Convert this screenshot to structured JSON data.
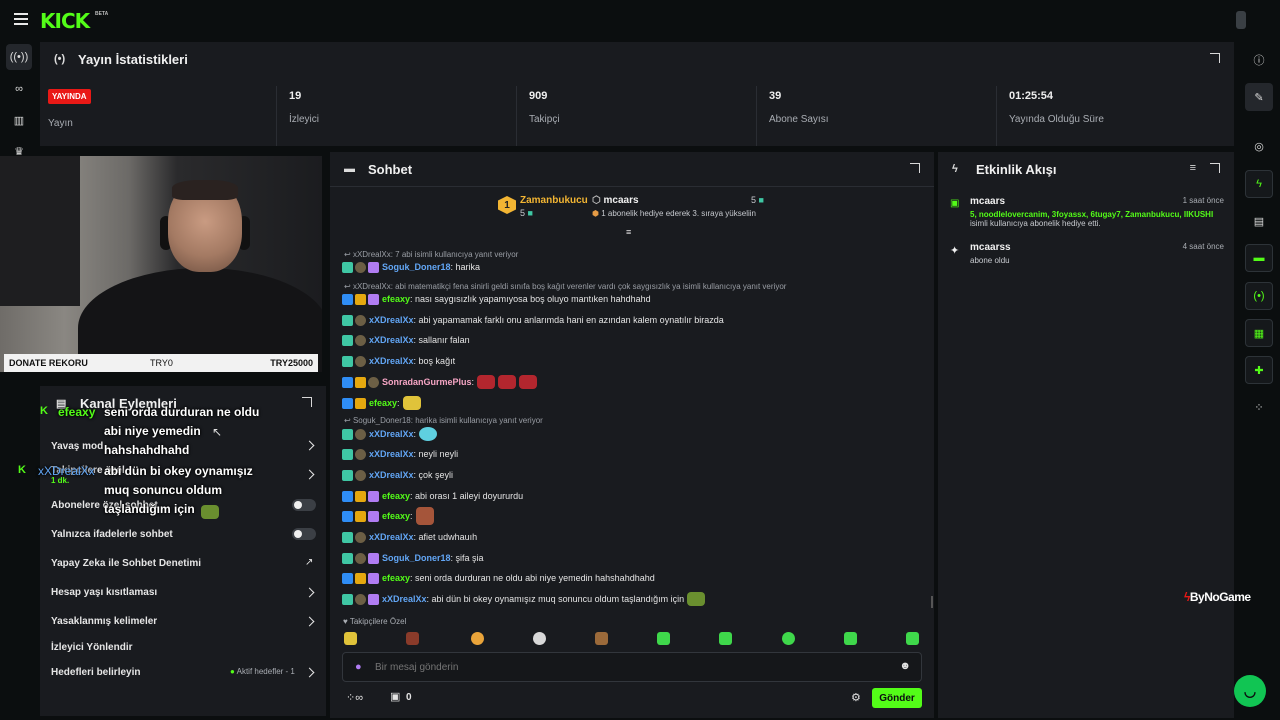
{
  "app": {
    "logo": "KICK",
    "beta": "BETA"
  },
  "stats": {
    "title": "Yayın İstatistikleri",
    "live_badge": "YAYINDA",
    "live_label": "Yayın",
    "viewers_value": "19",
    "viewers_label": "İzleyici",
    "followers_value": "909",
    "followers_label": "Takipçi",
    "subs_value": "39",
    "subs_label": "Abone Sayısı",
    "duration_value": "01:25:54",
    "duration_label": "Yayında Olduğu Süre"
  },
  "donate": {
    "label": "DONATE REKORU",
    "left": "TRY0",
    "right": "TRY25000"
  },
  "channel_actions": {
    "title": "Kanal Eylemleri",
    "items": [
      "Yavaş mod",
      "Takipçilere özel",
      "Abonelere özel sohbet",
      "Yalnızca ifadelerle sohbet",
      "Yapay Zeka ile Sohbet Denetimi",
      "Hesap yaşı kısıtlaması",
      "Yasaklanmış kelimeler",
      "İzleyici Yönlendir",
      "Hedefleri belirleyin"
    ],
    "goals_status": "Aktif hedefler - 1",
    "time_badge": "1 dk."
  },
  "overlay": {
    "user1": "efeaxy",
    "msg1_lines": [
      "seni orda durduran ne oldu",
      "abi niye yemedin",
      "hahshahdhahd"
    ],
    "user2": "xXDrealXx",
    "msg2_lines": [
      "abi dün bi okey oynamışız",
      "muq sonuncu oldum",
      "taşlandığım için"
    ]
  },
  "chat": {
    "title": "Sohbet",
    "pinned": {
      "rank": "1",
      "user1": "Zamanbukucu",
      "count1": "5",
      "user2": "mcaars",
      "count2": "5",
      "note": "1 abonelik hediye ederek 3. sıraya yükseliin"
    },
    "reply1": "xXDrealXx: 7 abi isimli kullanıcıya yanıt veriyor",
    "reply2": "xXDrealXx: abi matematikçi fena sinirli geldi sınıfa boş kağıt verenler vardı çok saygısızlık ya isimli kullanıcıya yanıt veriyor",
    "reply3": "Soguk_Doner18: harika isimli kullanıcıya yanıt veriyor",
    "messages": [
      {
        "user": "Soguk_Doner18",
        "text": "harika"
      },
      {
        "user": "efeaxy",
        "text": "nası saygısızlık yapamıyosa boş oluyo mantıken hahdhahd"
      },
      {
        "user": "xXDrealXx",
        "text": "abi yapamamak farklı onu anlarımda hani en azından kalem oynatılır birazda"
      },
      {
        "user": "xXDrealXx",
        "text": "sallanır falan"
      },
      {
        "user": "xXDrealXx",
        "text": "boş kağıt"
      },
      {
        "user": "SonradanGurmePlus",
        "text": ""
      },
      {
        "user": "efeaxy",
        "text": ""
      },
      {
        "user": "xXDrealXx",
        "text": ""
      },
      {
        "user": "xXDrealXx",
        "text": "neyli neyli"
      },
      {
        "user": "xXDrealXx",
        "text": "çok şeyli"
      },
      {
        "user": "efeaxy",
        "text": "abi orası 1 aileyi doyururdu"
      },
      {
        "user": "efeaxy",
        "text": ""
      },
      {
        "user": "xXDrealXx",
        "text": "afiet udwhauıh"
      },
      {
        "user": "Soguk_Doner18",
        "text": "şifa şia"
      },
      {
        "user": "efeaxy",
        "text": "seni orda durduran ne oldu abi niye yemedin hahshahdhahd"
      },
      {
        "user": "xXDrealXx",
        "text": "abi dün bi okey oynamışız muq sonuncu oldum taşlandığım için"
      }
    ],
    "followers_only": "Takipçilere Özel",
    "input_placeholder": "Bir mesaj gönderin",
    "count": "0",
    "send": "Gönder"
  },
  "events": {
    "title": "Etkinlik Akışı",
    "items": [
      {
        "user": "mcaars",
        "time": "1 saat önce",
        "names": "5, noodlelovercanim, 3foyassx, 6tugay7, Zamanbukucu, IIKUSHI",
        "desc": "isimli kullanıcıya abonelik hediye etti."
      },
      {
        "user": "mcaarss",
        "time": "4 saat önce",
        "names": "",
        "desc": "abone oldu"
      }
    ]
  },
  "watermark": "ByNoGame",
  "colors": {
    "accent": "#53fc18",
    "live": "#e91916",
    "panel": "#191b1f",
    "bg": "#0b0e0f"
  }
}
